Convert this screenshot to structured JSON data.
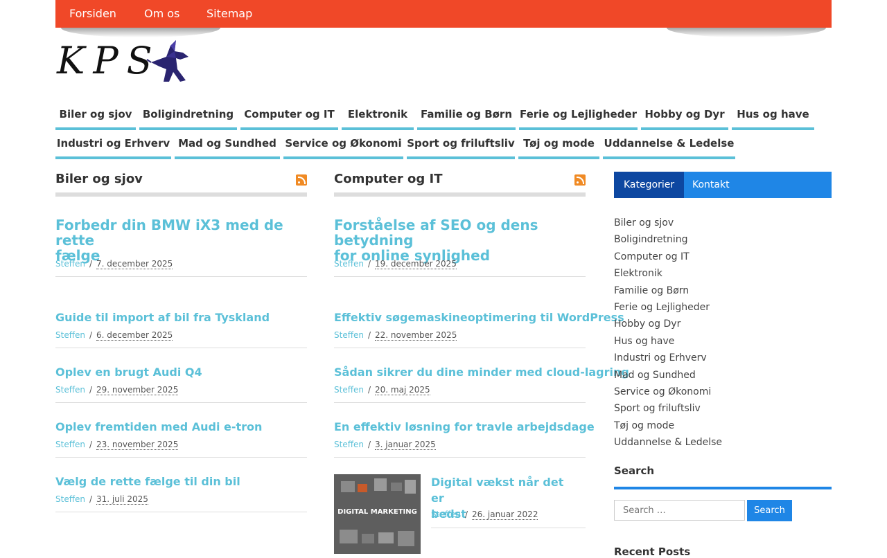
{
  "topnav": [
    "Forsiden",
    "Om os",
    "Sitemap"
  ],
  "logo_text": "KPS",
  "catnav": {
    "row1": [
      "Biler og sjov",
      "Boligindretning",
      "Computer og IT",
      "Elektronik",
      "Familie og Børn",
      "Ferie og Lejligheder",
      "Hobby og Dyr",
      "Hus og have"
    ],
    "row2": [
      "Industri og Erhverv",
      "Mad og Sundhed",
      "Service og Økonomi",
      "Sport og friluftsliv",
      "Tøj og mode",
      "Uddannelse & Ledelse"
    ]
  },
  "columns": [
    {
      "heading": "Biler og sjov",
      "lead": {
        "title_line1": "Forbedr din BMW iX3 med de rette",
        "title_line2": "fælge",
        "author": "Steffen",
        "date": "7. december 2025"
      },
      "posts": [
        {
          "title": "Guide til import af bil fra Tyskland",
          "author": "Steffen",
          "date": "6. december 2025"
        },
        {
          "title": "Oplev en brugt Audi Q4",
          "author": "Steffen",
          "date": "29. november 2025"
        },
        {
          "title": "Oplev fremtiden med Audi e-tron",
          "author": "Steffen",
          "date": "23. november 2025"
        },
        {
          "title": "Vælg de rette fælge til din bil",
          "author": "Steffen",
          "date": "31. juli 2025"
        }
      ]
    },
    {
      "heading": "Computer og IT",
      "lead": {
        "title_line1": "Forståelse af SEO og dens betydning",
        "title_line2": "for online synlighed",
        "author": "Steffen",
        "date": "19. december 2025"
      },
      "posts": [
        {
          "title": "Effektiv søgemaskineoptimering til WordPress",
          "author": "Steffen",
          "date": "22. november 2025"
        },
        {
          "title": "Sådan sikrer du dine minder med cloud-lagring",
          "author": "Steffen",
          "date": "20. maj 2025"
        },
        {
          "title": "En effektiv løsning for travle arbejdsdage",
          "author": "Steffen",
          "date": "3. januar 2025"
        },
        {
          "title_line1": "Digital vækst når det er",
          "title_line2": "bedst",
          "author": "Steffen",
          "date": "26. januar 2022",
          "thumb_text": "DIGITAL MARKETING"
        }
      ]
    }
  ],
  "sidebar": {
    "tabs": [
      "Kategorier",
      "Kontakt"
    ],
    "categories": [
      "Biler og sjov",
      "Boligindretning",
      "Computer og IT",
      "Elektronik",
      "Familie og Børn",
      "Ferie og Lejligheder",
      "Hobby og Dyr",
      "Hus og have",
      "Industri og Erhverv",
      "Mad og Sundhed",
      "Service og Økonomi",
      "Sport og friluftsliv",
      "Tøj og mode",
      "Uddannelse & Ledelse"
    ],
    "search_heading": "Search",
    "search_placeholder": "Search …",
    "search_button": "Search",
    "recent_heading": "Recent Posts"
  },
  "colors": {
    "topbar": "#f04828",
    "accent": "#5bc0d8",
    "blue": "#1f86e6",
    "dark_blue": "#0d47a1"
  }
}
